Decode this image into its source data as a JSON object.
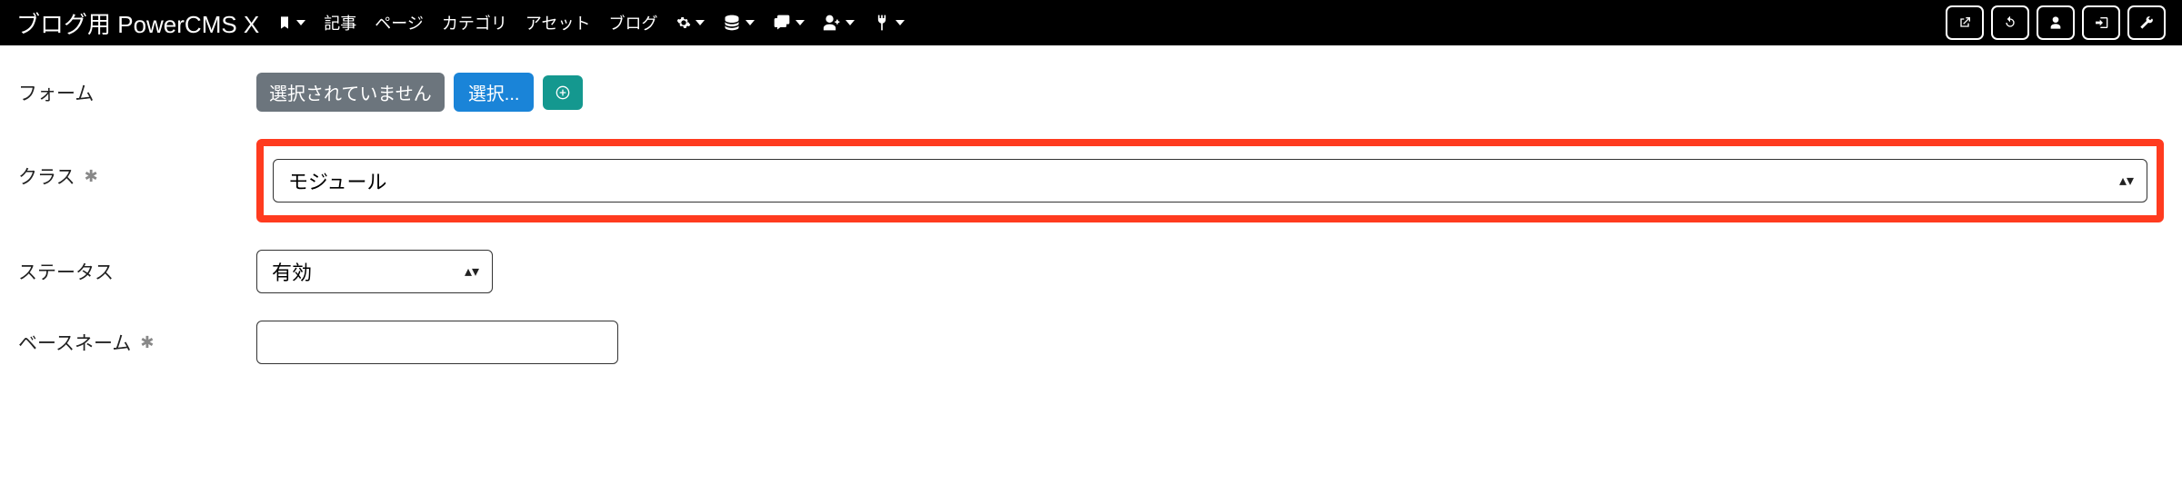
{
  "navbar": {
    "brand": "ブログ用 PowerCMS X",
    "items": [
      "記事",
      "ページ",
      "カテゴリ",
      "アセット",
      "ブログ"
    ]
  },
  "fields": {
    "form": {
      "label": "フォーム",
      "placeholder_badge": "選択されていません",
      "select_button": "選択..."
    },
    "klass": {
      "label": "クラス",
      "value": "モジュール"
    },
    "status": {
      "label": "ステータス",
      "value": "有効"
    },
    "basename": {
      "label": "ベースネーム",
      "value": ""
    }
  }
}
